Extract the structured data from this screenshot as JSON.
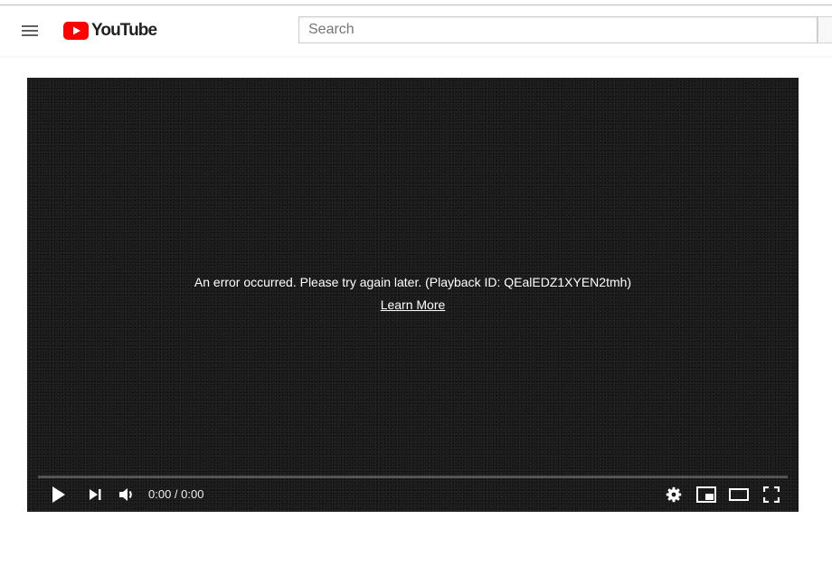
{
  "header": {
    "logo_text": "YouTube",
    "search": {
      "placeholder": "Search",
      "value": ""
    }
  },
  "player": {
    "error_message": "An error occurred. Please try again later. (Playback ID: QEalEDZ1XYEN2tmh)",
    "learn_more_label": "Learn More",
    "progress": 0,
    "time_display": "0:00 / 0:00",
    "controls": [
      "play-icon",
      "next-icon",
      "volume-icon",
      "settings-icon",
      "miniplayer-icon",
      "theater-mode-icon",
      "fullscreen-icon"
    ]
  },
  "colors": {
    "brand_red": "#ff0000",
    "player_bg": "#1b1b1b",
    "text_dark": "#212121"
  }
}
